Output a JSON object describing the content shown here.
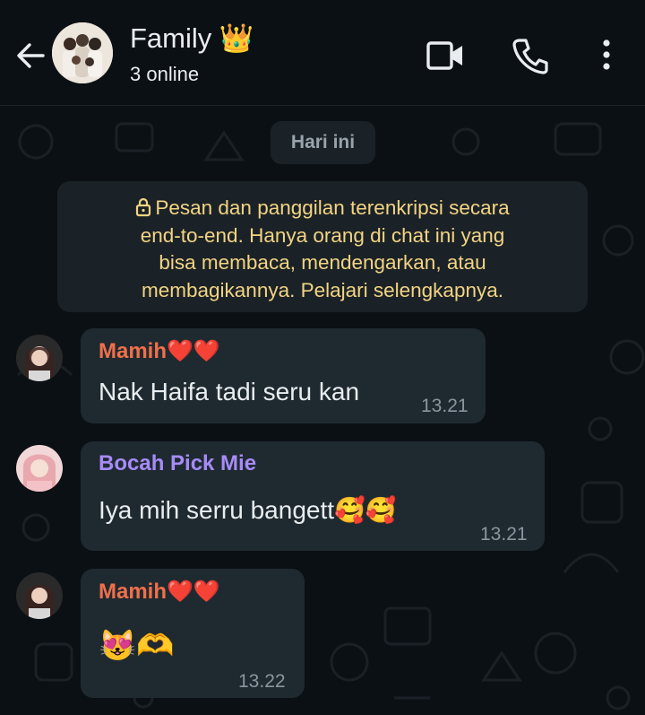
{
  "header": {
    "title": "Family",
    "title_emoji": "👑",
    "subtitle": "3 online"
  },
  "date_pill": "Hari ini",
  "notice": {
    "line1": "Pesan dan panggilan terenkripsi secara",
    "line2": "end-to-end. Hanya orang di chat ini yang",
    "line3": "bisa membaca, mendengarkan, atau",
    "line4": "membagikannya. Pelajari selengkapnya."
  },
  "messages": [
    {
      "sender": "Mamih",
      "sender_emoji": "❤️❤️",
      "text": "Nak Haifa tadi seru kan",
      "time": "13.21",
      "sender_color": "#f0704a"
    },
    {
      "sender": "Bocah Pick Mie",
      "text": "Iya mih serru bangett",
      "text_emoji": "🥰🥰",
      "time": "13.21",
      "sender_color": "#a78bfa"
    },
    {
      "sender": "Mamih",
      "sender_emoji": "❤️❤️",
      "text": "😻🫶",
      "time": "13.22",
      "sender_color": "#f0704a"
    }
  ],
  "colors": {
    "background": "#0b1014",
    "bubble": "#1f2a30",
    "notice_text": "#f2d483"
  }
}
